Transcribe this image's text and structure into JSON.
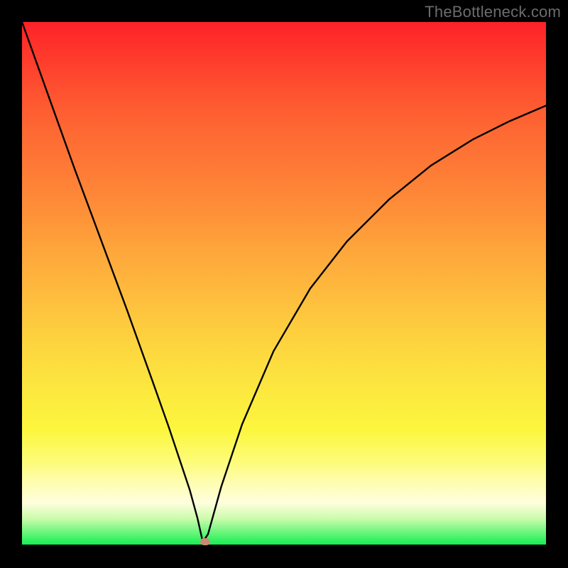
{
  "watermark": "TheBottleneck.com",
  "chart_data": {
    "type": "line",
    "title": "",
    "xlabel": "",
    "ylabel": "",
    "xlim": [
      0,
      100
    ],
    "ylim": [
      0,
      100
    ],
    "grid": false,
    "legend": false,
    "series": [
      {
        "name": "curve",
        "x": [
          0,
          5,
          10,
          15,
          20,
          25,
          28,
          30,
          32,
          33.5,
          34.5,
          35.5,
          38,
          42,
          48,
          55,
          62,
          70,
          78,
          86,
          93,
          100
        ],
        "y": [
          100,
          86,
          72,
          58.5,
          45,
          31,
          22.5,
          16.5,
          10.5,
          5,
          0.5,
          2,
          11,
          23,
          37,
          49,
          58,
          66,
          72.5,
          77.5,
          81,
          84
        ]
      }
    ],
    "marker": {
      "x": 35,
      "y": 0.6,
      "color": "#cb8a74"
    },
    "background_gradient": [
      "#fe2129",
      "#fdda3f",
      "#fcf63d",
      "#15ef52"
    ]
  }
}
